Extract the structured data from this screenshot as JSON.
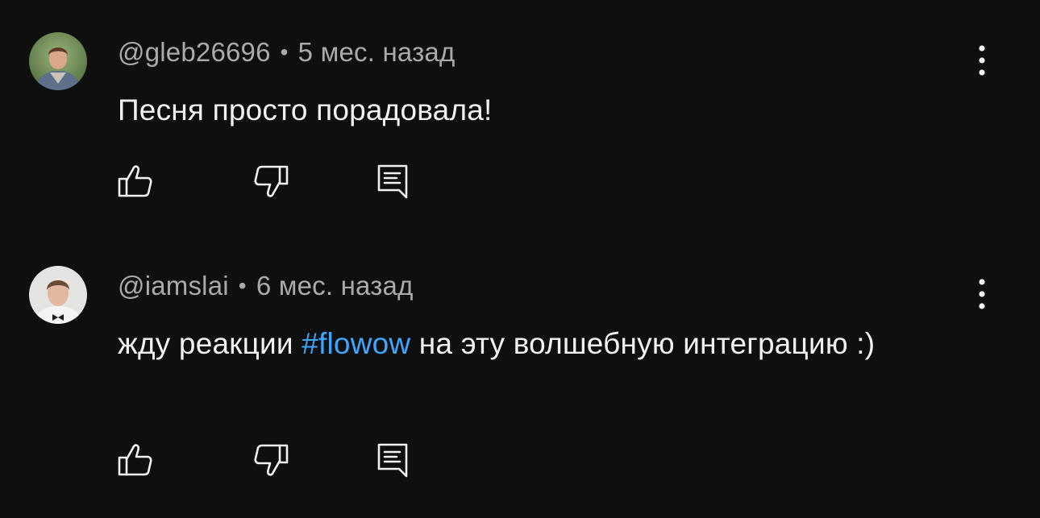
{
  "colors": {
    "background": "#0f0f0f",
    "text_primary": "#f1f1f1",
    "text_secondary": "#aaaaaa",
    "link": "#3ea6ff"
  },
  "comments": [
    {
      "author": "@gleb26696",
      "separator": "•",
      "time": "5 мес. назад",
      "text": "Песня просто порадовала!",
      "avatar_icon": "user-photo-avatar",
      "actions": [
        "thumbs-up-icon",
        "thumbs-down-icon",
        "reply-icon"
      ],
      "menu_icon": "more-vertical-icon"
    },
    {
      "author": "@iamslai",
      "separator": "•",
      "time": "6 мес. назад",
      "text_before": "жду реакции ",
      "hashtag": "#flowow",
      "text_after": " на эту волшебную интеграцию :)",
      "avatar_icon": "user-photo-avatar",
      "actions": [
        "thumbs-up-icon",
        "thumbs-down-icon",
        "reply-icon"
      ],
      "menu_icon": "more-vertical-icon"
    }
  ]
}
